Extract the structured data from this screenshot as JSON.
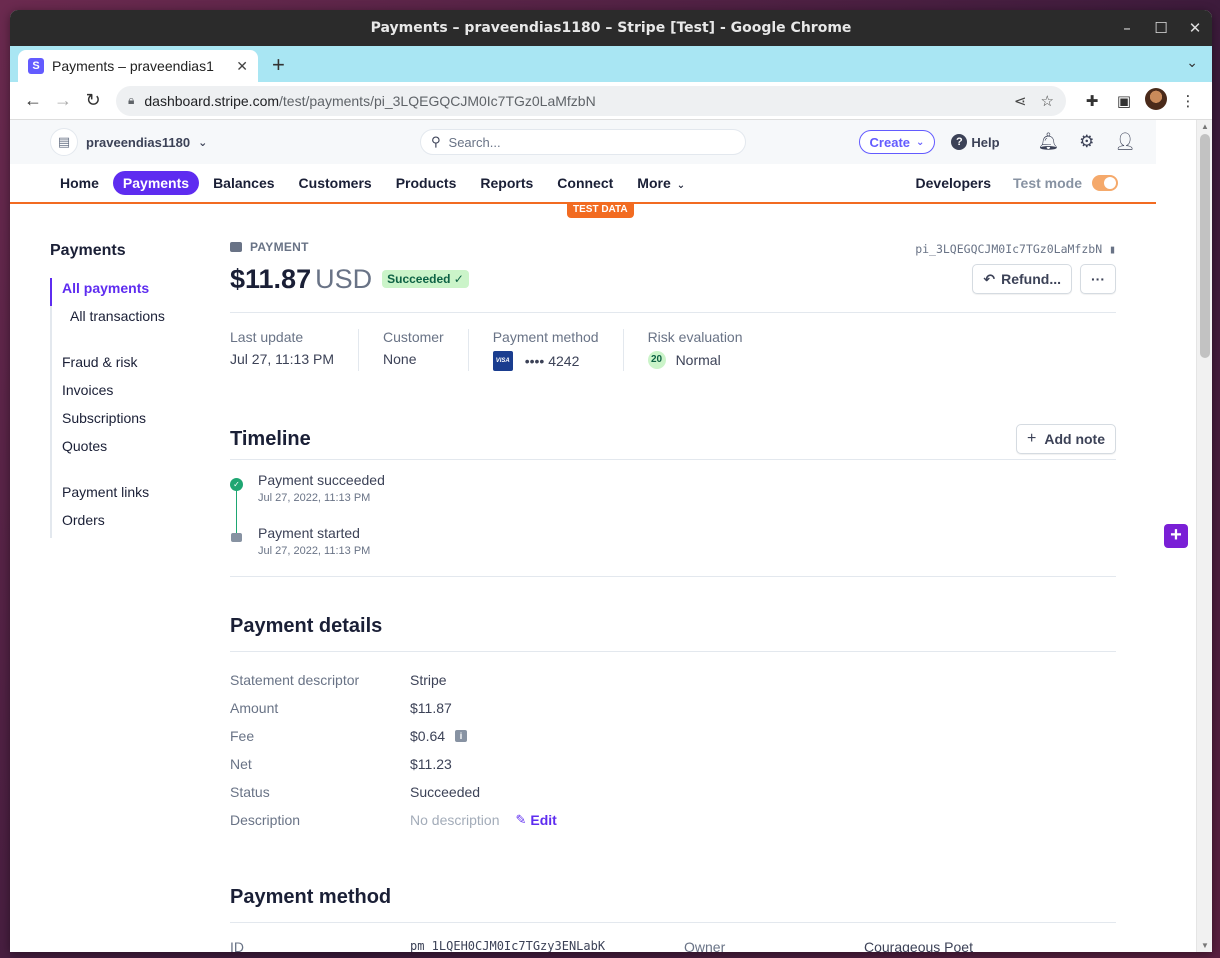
{
  "window": {
    "title": "Payments – praveendias1180 – Stripe [Test] - Google Chrome",
    "controls": [
      "–",
      "☐",
      "✕"
    ]
  },
  "browser": {
    "tab_title": "Payments – praveendias1",
    "tab_favicon": "S",
    "new_tab": "+",
    "url_host": "dashboard.stripe.com",
    "url_path": "/test/payments/pi_3LQEGQCJM0Ic7TGz0LaMfzbN"
  },
  "appbar": {
    "account": "praveendias1180",
    "search_placeholder": "Search...",
    "create_label": "Create",
    "help_label": "Help"
  },
  "nav": {
    "items": [
      "Home",
      "Payments",
      "Balances",
      "Customers",
      "Products",
      "Reports",
      "Connect",
      "More"
    ],
    "active": "Payments",
    "developers": "Developers",
    "test_mode": "Test mode",
    "test_data_badge": "TEST DATA"
  },
  "sidebar": {
    "title": "Payments",
    "items": [
      "All payments",
      "All transactions",
      "Fraud & risk",
      "Invoices",
      "Subscriptions",
      "Quotes",
      "Payment links",
      "Orders"
    ]
  },
  "payment": {
    "kicker": "PAYMENT",
    "id": "pi_3LQEGQCJM0Ic7TGz0LaMfzbN",
    "amount": "$11.87",
    "currency": "USD",
    "status_badge": "Succeeded ✓",
    "refund_label": "Refund...",
    "more_label": "···"
  },
  "summary": {
    "last_update_label": "Last update",
    "last_update_value": "Jul 27, 11:13 PM",
    "customer_label": "Customer",
    "customer_value": "None",
    "payment_method_label": "Payment method",
    "card_brand": "VISA",
    "card_value": "•••• 4242",
    "risk_label": "Risk evaluation",
    "risk_score": "20",
    "risk_value": "Normal"
  },
  "timeline": {
    "title": "Timeline",
    "add_note": "Add note",
    "events": [
      {
        "title": "Payment succeeded",
        "date": "Jul 27, 2022, 11:13 PM"
      },
      {
        "title": "Payment started",
        "date": "Jul 27, 2022, 11:13 PM"
      }
    ]
  },
  "details": {
    "title": "Payment details",
    "rows": [
      {
        "k": "Statement descriptor",
        "v": "Stripe"
      },
      {
        "k": "Amount",
        "v": "$11.87"
      },
      {
        "k": "Fee",
        "v": "$0.64"
      },
      {
        "k": "Net",
        "v": "$11.23"
      },
      {
        "k": "Status",
        "v": "Succeeded"
      },
      {
        "k": "Description",
        "v": "No description"
      }
    ],
    "edit_label": "Edit"
  },
  "payment_method": {
    "title": "Payment method",
    "id_label": "ID",
    "id_value": "pm_1LQEH0CJM0Ic7TGzy3ENLabK",
    "owner_label": "Owner",
    "owner_value": "Courageous Poet"
  },
  "colors": {
    "accent": "#5e2cf0",
    "test_orange": "#f26b21",
    "success_bg": "#cbf4c9",
    "success_fg": "#0e6245"
  }
}
